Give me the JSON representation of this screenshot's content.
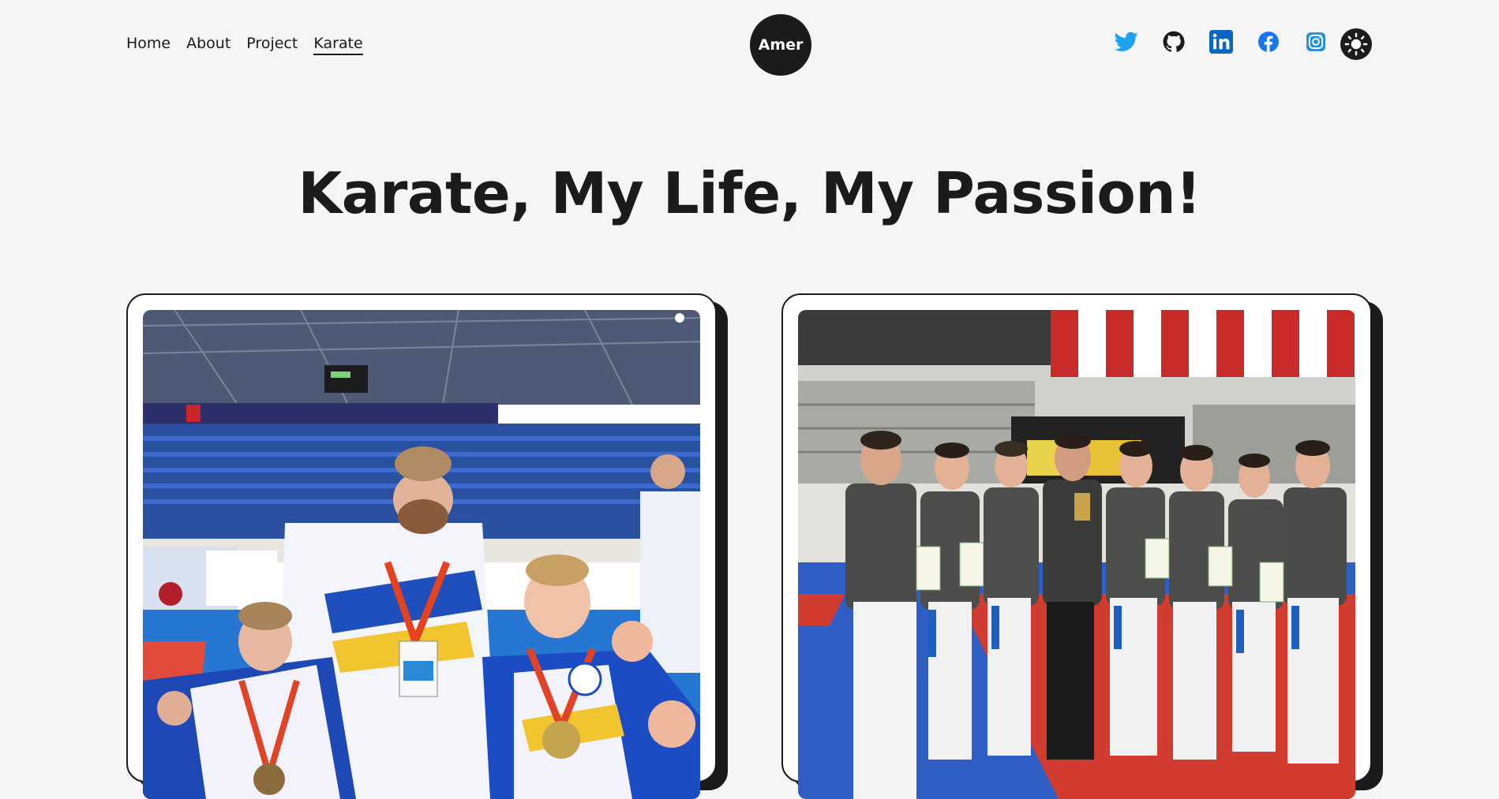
{
  "nav": {
    "items": [
      {
        "label": "Home"
      },
      {
        "label": "About"
      },
      {
        "label": "Project"
      },
      {
        "label": "Karate"
      }
    ],
    "active": "Karate"
  },
  "logo": {
    "text": "Amer"
  },
  "socials": [
    {
      "name": "twitter-icon",
      "color": "#1da1f2"
    },
    {
      "name": "github-icon",
      "color": "#1b1b1b"
    },
    {
      "name": "linkedin-icon",
      "color": "#0a66c2"
    },
    {
      "name": "facebook-icon",
      "color": "#1877f2"
    },
    {
      "name": "instagram-icon",
      "color": "#1d8fe1"
    }
  ],
  "theme_toggle": {
    "icon": "sun-icon"
  },
  "hero": {
    "title": "Karate, My Life, My Passion!"
  },
  "cards": [
    {
      "image": "karate-medalists-photo"
    },
    {
      "image": "karate-team-photo"
    }
  ],
  "colors": {
    "background": "#f5f5f5",
    "dark": "#1b1b1b",
    "card": "#ffffff"
  }
}
